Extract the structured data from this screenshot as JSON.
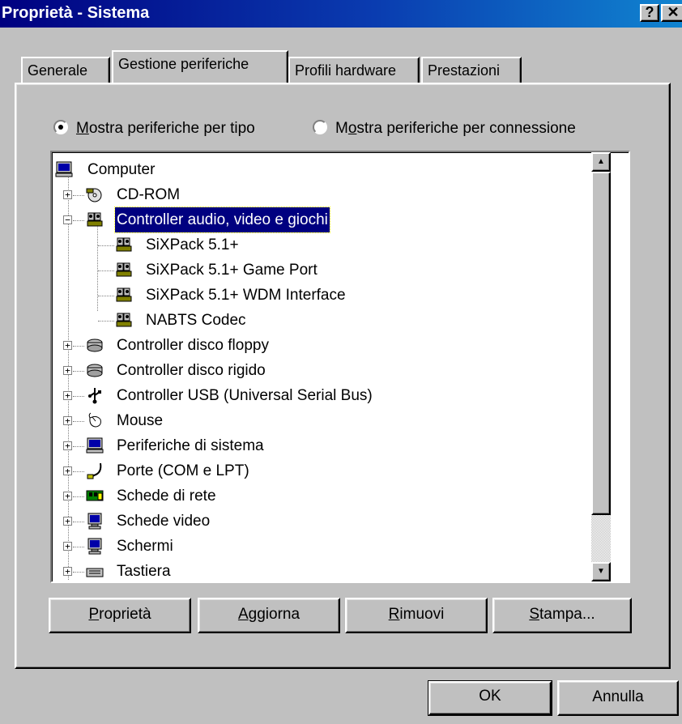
{
  "window": {
    "title": "Proprietà - Sistema",
    "help_label": "?",
    "close_label": "✕"
  },
  "tabs": [
    {
      "label": "Generale",
      "active": false
    },
    {
      "label": "Gestione periferiche",
      "active": true
    },
    {
      "label": "Profili hardware",
      "active": false
    },
    {
      "label": "Prestazioni",
      "active": false
    }
  ],
  "view_options": {
    "by_type": {
      "accel": "M",
      "rest": "ostra periferiche per tipo",
      "checked": true
    },
    "by_connection": {
      "pre": "M",
      "accel": "o",
      "rest": "stra periferiche per connessione",
      "checked": false
    }
  },
  "tree": {
    "root": {
      "label": "Computer",
      "icon": "computer-icon"
    },
    "items": [
      {
        "label": "CD-ROM",
        "icon": "cdrom-icon",
        "expander": "+"
      },
      {
        "label": "Controller audio, video e giochi",
        "icon": "multimedia-icon",
        "expander": "−",
        "selected": true
      },
      {
        "label": "SiXPack 5.1+",
        "icon": "multimedia-icon",
        "child": true
      },
      {
        "label": "SiXPack 5.1+ Game Port",
        "icon": "multimedia-icon",
        "child": true
      },
      {
        "label": "SiXPack 5.1+ WDM Interface",
        "icon": "multimedia-icon",
        "child": true
      },
      {
        "label": "NABTS Codec",
        "icon": "multimedia-icon",
        "child": true
      },
      {
        "label": "Controller disco floppy",
        "icon": "disk-controller-icon",
        "expander": "+"
      },
      {
        "label": "Controller disco rigido",
        "icon": "disk-controller-icon",
        "expander": "+"
      },
      {
        "label": "Controller USB (Universal Serial Bus)",
        "icon": "usb-icon",
        "expander": "+"
      },
      {
        "label": "Mouse",
        "icon": "mouse-icon",
        "expander": "+"
      },
      {
        "label": "Periferiche di sistema",
        "icon": "computer-icon",
        "expander": "+"
      },
      {
        "label": "Porte (COM e LPT)",
        "icon": "port-icon",
        "expander": "+"
      },
      {
        "label": "Schede di rete",
        "icon": "network-card-icon",
        "expander": "+"
      },
      {
        "label": "Schede video",
        "icon": "monitor-icon",
        "expander": "+"
      },
      {
        "label": "Schermi",
        "icon": "monitor-icon",
        "expander": "+"
      },
      {
        "label": "Tastiera",
        "icon": "keyboard-icon",
        "expander": "+"
      }
    ]
  },
  "buttons": {
    "properties": {
      "accel": "P",
      "rest": "roprietà"
    },
    "refresh": {
      "accel": "A",
      "rest": "ggiorna"
    },
    "remove": {
      "accel": "R",
      "rest": "imuovi"
    },
    "print": {
      "accel": "S",
      "rest": "tampa..."
    },
    "ok": "OK",
    "cancel": "Annulla"
  },
  "colors": {
    "selection": "#000080",
    "face": "#c0c0c0"
  }
}
